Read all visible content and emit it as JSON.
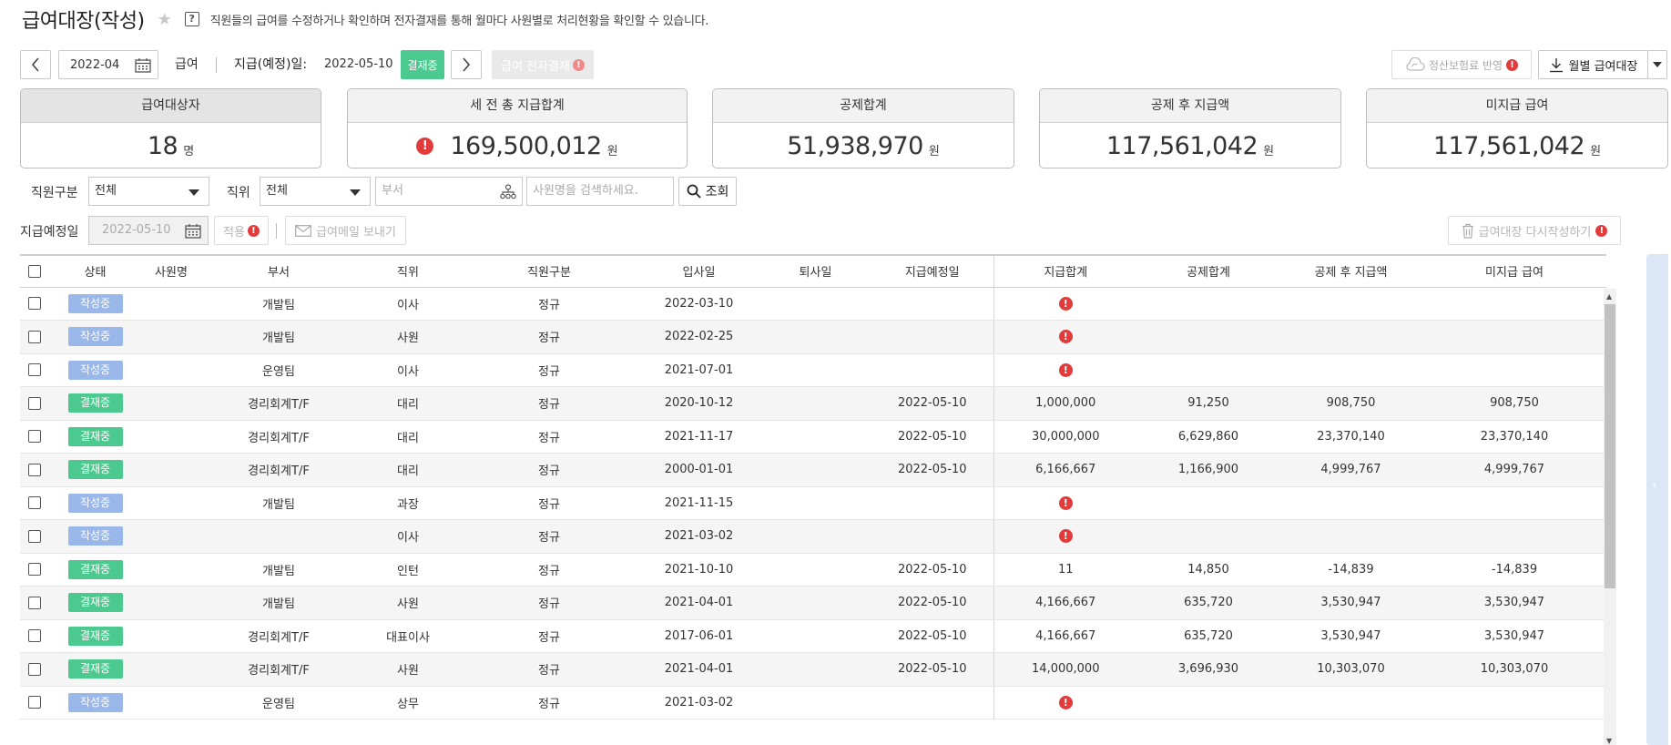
{
  "header": {
    "title": "급여대장(작성)",
    "description": "직원들의 급여를 수정하거나 확인하며 전자결재를 통해 월마다 사원별로 처리현황을 확인할 수 있습니다."
  },
  "toolbar": {
    "month": "2022-04",
    "salary_label": "급여",
    "pay_date_label": "지급(예정)일:",
    "pay_date": "2022-05-10",
    "approval_badge": "결재중",
    "e_approval_button": "급여 전자결재",
    "insurance_button": "정산보험료 반영",
    "monthly_ledger_button": "월별 급여대장"
  },
  "summary": [
    {
      "label": "급여대상자",
      "value": "18",
      "unit": "명",
      "alert": false
    },
    {
      "label": "세 전 총 지급합계",
      "value": "169,500,012",
      "unit": "원",
      "alert": true
    },
    {
      "label": "공제합계",
      "value": "51,938,970",
      "unit": "원",
      "alert": false
    },
    {
      "label": "공제 후 지급액",
      "value": "117,561,042",
      "unit": "원",
      "alert": false
    },
    {
      "label": "미지급 급여",
      "value": "117,561,042",
      "unit": "원",
      "alert": false
    }
  ],
  "filters": {
    "emp_type_label": "직원구분",
    "emp_type_value": "전체",
    "position_label": "직위",
    "position_value": "전체",
    "dept_placeholder": "부서",
    "name_placeholder": "사원명을 검색하세요.",
    "search_button": "조회"
  },
  "paydate_row": {
    "label": "지급예정일",
    "date": "2022-05-10",
    "apply_button": "적용",
    "send_mail_button": "급여메일 보내기",
    "rewrite_button": "급여대장 다시작성하기"
  },
  "table": {
    "columns": [
      "상태",
      "사원명",
      "부서",
      "직위",
      "직원구분",
      "입사일",
      "퇴사일",
      "지급예정일",
      "지급합계",
      "공제합계",
      "공제 후 지급액",
      "미지급 급여"
    ],
    "rows": [
      {
        "status": "작성중",
        "status_type": "writing",
        "name": "",
        "dept": "개발팀",
        "position": "이사",
        "emp_type": "정규",
        "join": "2022-03-10",
        "leave": "",
        "paydate": "",
        "total": "",
        "total_alert": true,
        "deduct": "",
        "net": "",
        "unpaid": ""
      },
      {
        "status": "작성중",
        "status_type": "writing",
        "name": "",
        "dept": "개발팀",
        "position": "사원",
        "emp_type": "정규",
        "join": "2022-02-25",
        "leave": "",
        "paydate": "",
        "total": "",
        "total_alert": true,
        "deduct": "",
        "net": "",
        "unpaid": ""
      },
      {
        "status": "작성중",
        "status_type": "writing",
        "name": "",
        "dept": "운영팀",
        "position": "이사",
        "emp_type": "정규",
        "join": "2021-07-01",
        "leave": "",
        "paydate": "",
        "total": "",
        "total_alert": true,
        "deduct": "",
        "net": "",
        "unpaid": ""
      },
      {
        "status": "결재중",
        "status_type": "approval",
        "name": "",
        "dept": "경리회계T/F",
        "position": "대리",
        "emp_type": "정규",
        "join": "2020-10-12",
        "leave": "",
        "paydate": "2022-05-10",
        "total": "1,000,000",
        "total_alert": false,
        "deduct": "91,250",
        "net": "908,750",
        "unpaid": "908,750"
      },
      {
        "status": "결재중",
        "status_type": "approval",
        "name": "",
        "dept": "경리회계T/F",
        "position": "대리",
        "emp_type": "정규",
        "join": "2021-11-17",
        "leave": "",
        "paydate": "2022-05-10",
        "total": "30,000,000",
        "total_alert": false,
        "deduct": "6,629,860",
        "net": "23,370,140",
        "unpaid": "23,370,140"
      },
      {
        "status": "결재중",
        "status_type": "approval",
        "name": "",
        "dept": "경리회계T/F",
        "position": "대리",
        "emp_type": "정규",
        "join": "2000-01-01",
        "leave": "",
        "paydate": "2022-05-10",
        "total": "6,166,667",
        "total_alert": false,
        "deduct": "1,166,900",
        "net": "4,999,767",
        "unpaid": "4,999,767"
      },
      {
        "status": "작성중",
        "status_type": "writing",
        "name": "",
        "dept": "개발팀",
        "position": "과장",
        "emp_type": "정규",
        "join": "2021-11-15",
        "leave": "",
        "paydate": "",
        "total": "",
        "total_alert": true,
        "deduct": "",
        "net": "",
        "unpaid": ""
      },
      {
        "status": "작성중",
        "status_type": "writing",
        "name": "",
        "dept": "",
        "position": "이사",
        "emp_type": "정규",
        "join": "2021-03-02",
        "leave": "",
        "paydate": "",
        "total": "",
        "total_alert": true,
        "deduct": "",
        "net": "",
        "unpaid": ""
      },
      {
        "status": "결재중",
        "status_type": "approval",
        "name": "",
        "dept": "개발팀",
        "position": "인턴",
        "emp_type": "정규",
        "join": "2021-10-10",
        "leave": "",
        "paydate": "2022-05-10",
        "total": "11",
        "total_alert": false,
        "deduct": "14,850",
        "net": "-14,839",
        "unpaid": "-14,839"
      },
      {
        "status": "결재중",
        "status_type": "approval",
        "name": "",
        "dept": "개발팀",
        "position": "사원",
        "emp_type": "정규",
        "join": "2021-04-01",
        "leave": "",
        "paydate": "2022-05-10",
        "total": "4,166,667",
        "total_alert": false,
        "deduct": "635,720",
        "net": "3,530,947",
        "unpaid": "3,530,947"
      },
      {
        "status": "결재중",
        "status_type": "approval",
        "name": "",
        "dept": "경리회계T/F",
        "position": "대표이사",
        "emp_type": "정규",
        "join": "2017-06-01",
        "leave": "",
        "paydate": "2022-05-10",
        "total": "4,166,667",
        "total_alert": false,
        "deduct": "635,720",
        "net": "3,530,947",
        "unpaid": "3,530,947"
      },
      {
        "status": "결재중",
        "status_type": "approval",
        "name": "",
        "dept": "경리회계T/F",
        "position": "사원",
        "emp_type": "정규",
        "join": "2021-04-01",
        "leave": "",
        "paydate": "2022-05-10",
        "total": "14,000,000",
        "total_alert": false,
        "deduct": "3,696,930",
        "net": "10,303,070",
        "unpaid": "10,303,070"
      },
      {
        "status": "작성중",
        "status_type": "writing",
        "name": "",
        "dept": "운영팀",
        "position": "상무",
        "emp_type": "정규",
        "join": "2021-03-02",
        "leave": "",
        "paydate": "",
        "total": "",
        "total_alert": true,
        "deduct": "",
        "net": "",
        "unpaid": ""
      }
    ]
  }
}
